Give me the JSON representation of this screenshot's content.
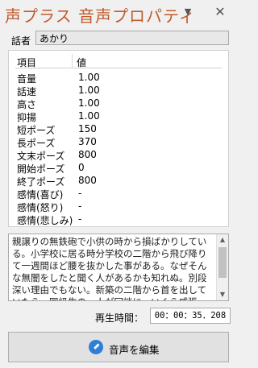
{
  "window": {
    "title": "声プラス 音声プロパティ",
    "dropdown_icon": "▼",
    "close_icon": "✕"
  },
  "speaker": {
    "label": "話者",
    "value": "あかり"
  },
  "properties": {
    "col_item": "項目",
    "col_value": "値",
    "rows": [
      {
        "key": "音量",
        "value": "1.00"
      },
      {
        "key": "話速",
        "value": "1.00"
      },
      {
        "key": "高さ",
        "value": "1.00"
      },
      {
        "key": "抑揚",
        "value": "1.00"
      },
      {
        "key": "短ポーズ",
        "value": "150"
      },
      {
        "key": "長ポーズ",
        "value": "370"
      },
      {
        "key": "文末ポーズ",
        "value": "800"
      },
      {
        "key": "開始ポーズ",
        "value": "0"
      },
      {
        "key": "終了ポーズ",
        "value": "800"
      },
      {
        "key": "感情(喜び)",
        "value": "-"
      },
      {
        "key": "感情(怒り)",
        "value": "-"
      },
      {
        "key": "感情(悲しみ)",
        "value": "-"
      }
    ]
  },
  "text": {
    "content": "親譲りの無鉄砲で小供の時から損ばかりしている。小学校に居る時分学校の二階から飛び降りて一週間ほど腰を抜かした事がある。なぜそんな無闇をしたと聞く人があるかも知れぬ。別段深い理由でもない。新築の二階から首を出していたら、同級生の一人が冗談に、いくら威張っても、そこから飛び降りる事は出来まい。弱虫やーい。と囃したからである。"
  },
  "playback": {
    "label": "再生時間：",
    "value": "00：00：35．208"
  },
  "edit_button": {
    "label": "音声を編集",
    "icon": "pen-icon"
  }
}
